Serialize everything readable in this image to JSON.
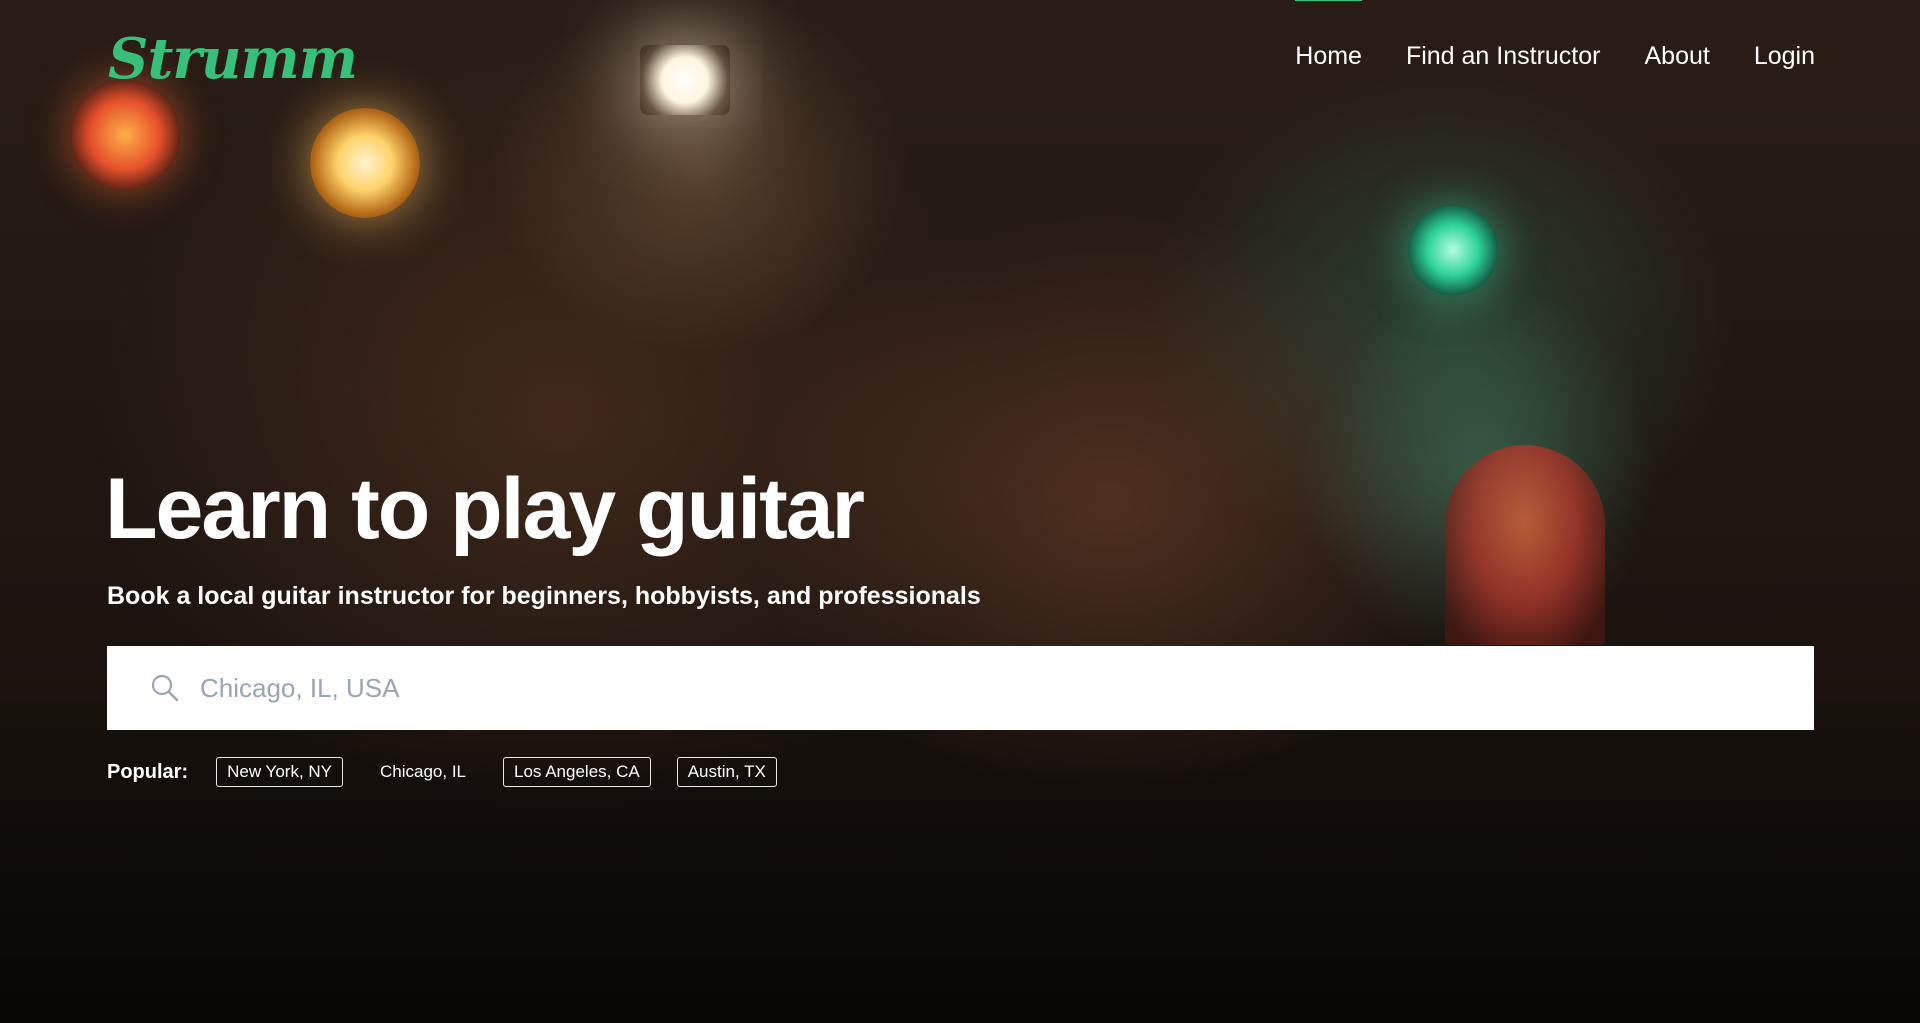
{
  "brand": {
    "logo_text": "Strumm",
    "accent_color": "#37c07a"
  },
  "nav": {
    "items": [
      {
        "label": "Home",
        "active": true
      },
      {
        "label": "Find an Instructor",
        "active": false
      },
      {
        "label": "About",
        "active": false
      },
      {
        "label": "Login",
        "active": false
      }
    ]
  },
  "hero": {
    "headline": "Learn to play guitar",
    "subheadline": "Book a local guitar instructor for beginners, hobbyists, and professionals",
    "search": {
      "placeholder": "Chicago, IL, USA",
      "value": "",
      "icon": "search-icon"
    },
    "popular": {
      "label": "Popular:",
      "locations": [
        {
          "label": "New York, NY",
          "outlined": true
        },
        {
          "label": "Chicago, IL",
          "outlined": false
        },
        {
          "label": "Los Angeles, CA",
          "outlined": true
        },
        {
          "label": "Austin, TX",
          "outlined": true
        }
      ]
    }
  }
}
